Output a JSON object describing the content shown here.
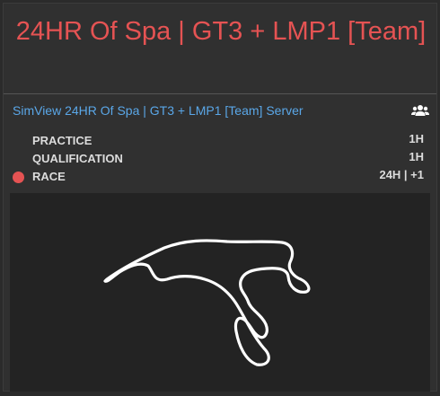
{
  "event": {
    "title": "24HR Of Spa | GT3 + LMP1 [Team]"
  },
  "server": {
    "name": "SimView 24HR Of Spa | GT3 + LMP1 [Team] Server",
    "icon": "users-icon"
  },
  "sessions": [
    {
      "label": "PRACTICE",
      "duration": "1H",
      "active": false
    },
    {
      "label": "QUALIFICATION",
      "duration": "1H",
      "active": false
    },
    {
      "label": "RACE",
      "duration": "24H | +1",
      "active": true
    }
  ],
  "colors": {
    "accent": "#e55353",
    "link": "#5aa7e8",
    "track": "#ffffff"
  },
  "track_map": {
    "icon": "spa-track-outline"
  }
}
